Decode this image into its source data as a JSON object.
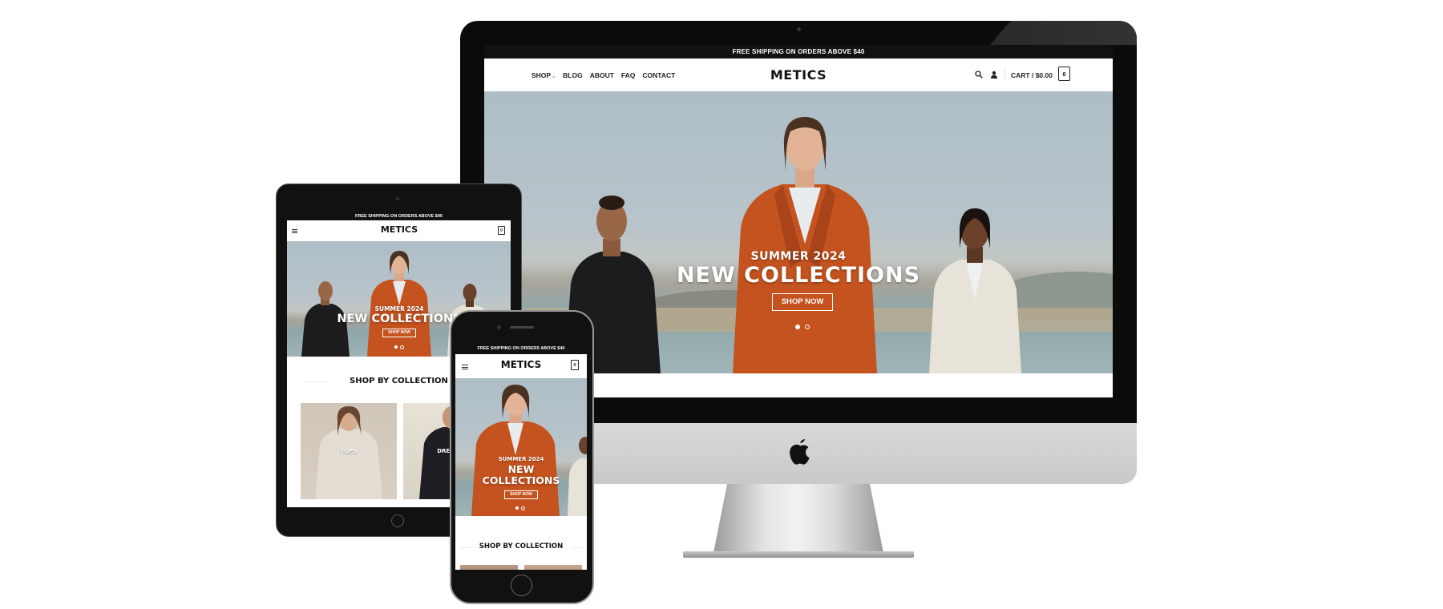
{
  "desktop": {
    "announcement": "FREE SHIPPING ON ORDERS ABOVE $40",
    "nav": [
      {
        "label": "SHOP",
        "icon": "chevron-down-icon"
      },
      {
        "label": "BLOG"
      },
      {
        "label": "ABOUT"
      },
      {
        "label": "FAQ"
      },
      {
        "label": "CONTACT"
      }
    ],
    "logo": "METICS",
    "cart_label": "CART / $0.00",
    "cart_count": "0",
    "hero": {
      "kicker": "SUMMER 2024",
      "headline": "NEW COLLECTIONS",
      "button": "SHOP NOW",
      "slides": 2,
      "active_slide": 1
    }
  },
  "tablet": {
    "announcement": "FREE SHIPPING ON ORDERS ABOVE $40",
    "logo": "METICS",
    "cart_count": "0",
    "hero": {
      "kicker": "SUMMER 2024",
      "headline": "NEW COLLECTIONS",
      "button": "SHOP NOW"
    },
    "section_title": "SHOP BY COLLECTION",
    "collections": [
      {
        "label": "TOPS"
      },
      {
        "label": "DRESSES"
      }
    ]
  },
  "mobile": {
    "announcement": "FREE SHIPPING ON ORDERS ABOVE $40",
    "logo": "METICS",
    "cart_count": "0",
    "hero": {
      "kicker": "SUMMER 2024",
      "headline_line1": "NEW",
      "headline_line2": "COLLECTIONS",
      "button": "SHOP NOW"
    },
    "section_title": "SHOP BY COLLECTION"
  },
  "colors": {
    "announcement_bg": "#111111",
    "jacket_orange": "#c4531f",
    "device_black": "#0b0b0b",
    "imac_silver": "#d2d2d4"
  }
}
